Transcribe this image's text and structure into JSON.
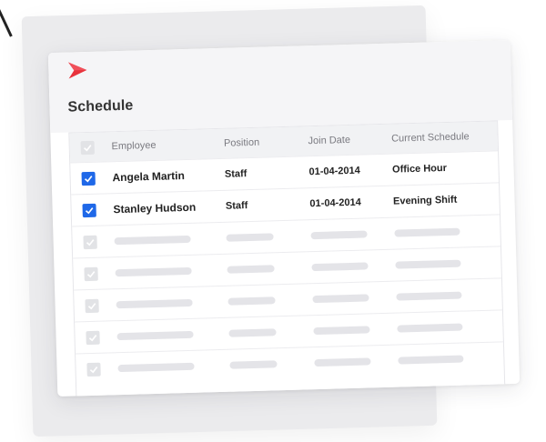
{
  "header": {
    "title": "Schedule",
    "logo": "red-chevron-logo"
  },
  "table": {
    "columns": [
      "Employee",
      "Position",
      "Join Date",
      "Current Schedule"
    ],
    "rows": [
      {
        "checked": true,
        "employee": "Angela Martin",
        "position": "Staff",
        "join_date": "01-04-2014",
        "schedule": "Office Hour"
      },
      {
        "checked": true,
        "employee": "Stanley Hudson",
        "position": "Staff",
        "join_date": "01-04-2014",
        "schedule": "Evening Shift"
      }
    ],
    "placeholder_rows": 5
  },
  "colors": {
    "accent": "#1f68e8",
    "logo": "#e8323c"
  }
}
